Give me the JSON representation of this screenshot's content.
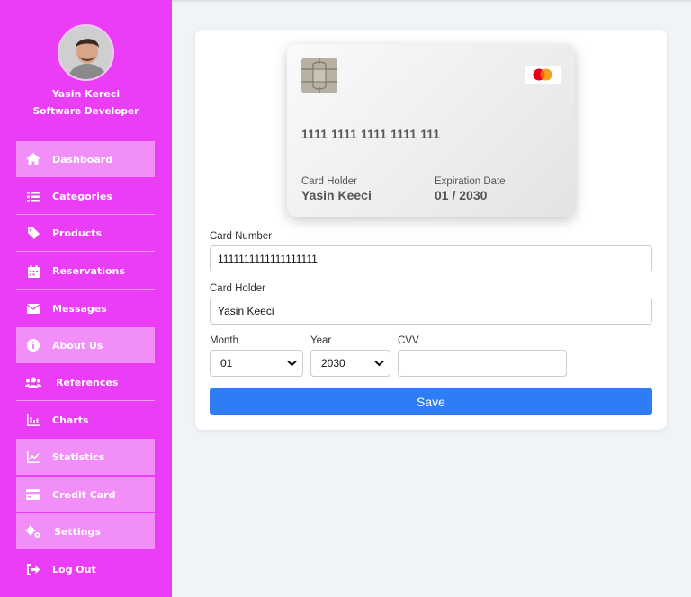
{
  "profile": {
    "name": "Yasin Kereci",
    "role": "Software Developer"
  },
  "sidebar": {
    "items": [
      {
        "label": "Dashboard",
        "icon": "home-icon"
      },
      {
        "label": "Categories",
        "icon": "list-icon"
      },
      {
        "label": "Products",
        "icon": "tag-icon"
      },
      {
        "label": "Reservations",
        "icon": "calendar-icon"
      },
      {
        "label": "Messages",
        "icon": "envelope-icon"
      },
      {
        "label": "About Us",
        "icon": "info-icon"
      },
      {
        "label": "References",
        "icon": "users-icon"
      },
      {
        "label": "Charts",
        "icon": "chart-icon"
      },
      {
        "label": "Statistics",
        "icon": "line-chart-icon"
      },
      {
        "label": "Credit Card",
        "icon": "credit-card-icon"
      },
      {
        "label": "Settings",
        "icon": "cogs-icon"
      },
      {
        "label": "Log Out",
        "icon": "sign-out-icon"
      }
    ]
  },
  "card_preview": {
    "number": "1111 1111 1111 1111 111",
    "holder_label": "Card Holder",
    "holder_name": "Yasin Keeci",
    "expiration_label": "Expiration Date",
    "expiration": "01 / 2030"
  },
  "form": {
    "card_number_label": "Card Number",
    "card_number_value": "1111111111111111111",
    "card_holder_label": "Card Holder",
    "card_holder_value": "Yasin Keeci",
    "month_label": "Month",
    "month_value": "01",
    "year_label": "Year",
    "year_value": "2030",
    "cvv_label": "CVV",
    "cvv_value": "",
    "save_label": "Save"
  },
  "colors": {
    "sidebar": "#ea3df5",
    "highlight": "#f28ef8",
    "save": "#2f7df6"
  }
}
